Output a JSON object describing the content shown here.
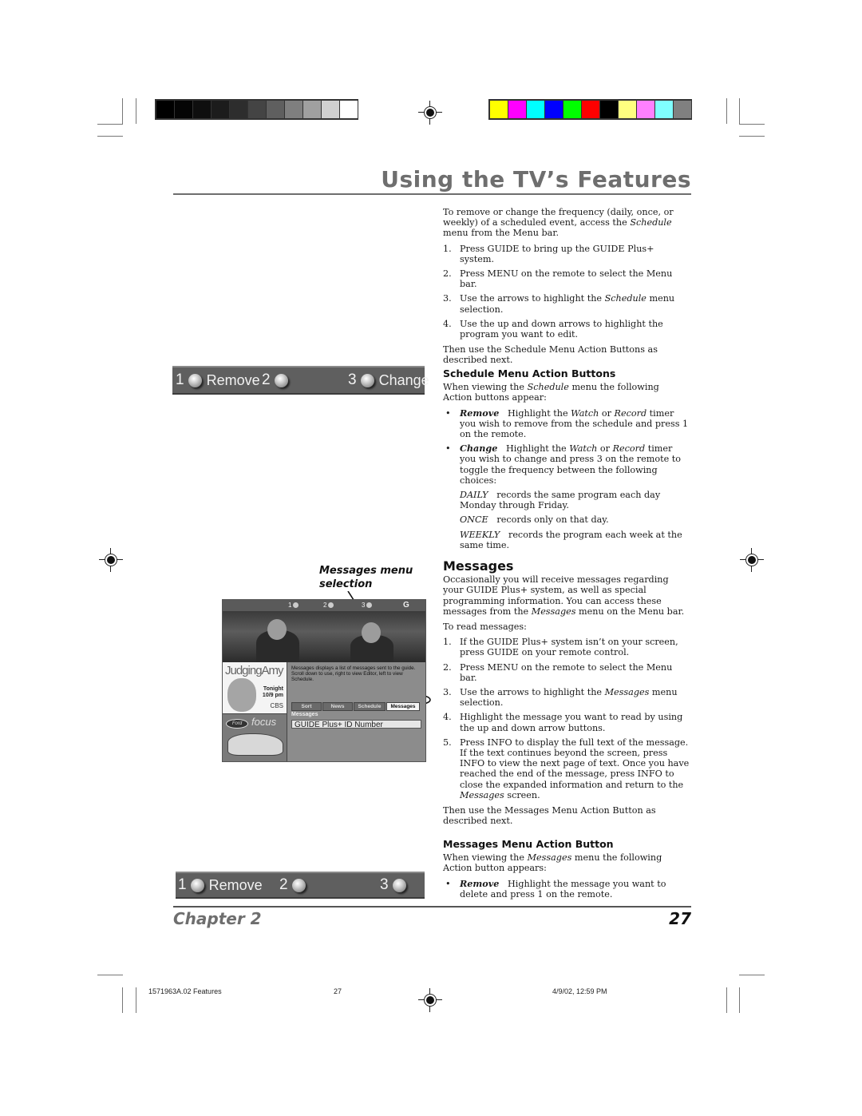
{
  "print_marks": {
    "grayscale_bar": [
      "#000000",
      "#050505",
      "#0f0f0f",
      "#1c1c1c",
      "#2d2d2d",
      "#444444",
      "#5f5f5f",
      "#7f7f7f",
      "#a0a0a0",
      "#d0d0d0",
      "#ffffff"
    ],
    "color_bar": [
      "#ffff00",
      "#ff00ff",
      "#00ffff",
      "#0000ff",
      "#00ff00",
      "#ff0000",
      "#000000",
      "#ffff80",
      "#ff80ff",
      "#80ffff",
      "#808080"
    ]
  },
  "header": {
    "title": "Using the TV’s Features"
  },
  "intro": {
    "p1_a": "To remove or change the frequency (daily, once, or weekly) of a scheduled event, access the ",
    "p1_em": "Schedule",
    "p1_b": " menu from the Menu bar.",
    "steps": [
      {
        "n": "1.",
        "a": "Press GUIDE to bring up the GUIDE Plus+ system.",
        "em": "",
        "b": ""
      },
      {
        "n": "2.",
        "a": "Press MENU on the remote to select the Menu bar.",
        "em": "",
        "b": ""
      },
      {
        "n": "3.",
        "a": "Use the arrows to highlight the ",
        "em": "Schedule",
        "b": " menu selection."
      },
      {
        "n": "4.",
        "a": "Use the up and down arrows to highlight the program you want to edit.",
        "em": "",
        "b": ""
      }
    ],
    "closing": "Then use the Schedule Menu Action Buttons as described next."
  },
  "schedule_action_bar": {
    "k1": "1",
    "k1_label": "Remove",
    "k2": "2",
    "k2_label": "",
    "k3": "3",
    "k3_label": "Change"
  },
  "schedule_section": {
    "heading": "Schedule Menu Action Buttons",
    "intro_a": "When viewing the ",
    "intro_em": "Schedule",
    "intro_b": " menu the following Action buttons appear:",
    "bullet": "•",
    "remove_term": "Remove",
    "remove_a": "Highlight the ",
    "remove_em1": "Watch",
    "remove_b": " or ",
    "remove_em2": "Record",
    "remove_c": " timer you wish to remove from the schedule and press 1 on the remote.",
    "change_term": "Change",
    "change_a": "Highlight the ",
    "change_em1": "Watch",
    "change_b": " or ",
    "change_em2": "Record",
    "change_c": " timer you wish to change and press 3 on the remote to toggle the frequency between the following choices:",
    "choices": [
      {
        "term": "DAILY",
        "desc": "records the same program each day Monday through Friday."
      },
      {
        "term": "ONCE",
        "desc": "records only on that day."
      },
      {
        "term": "WEEKLY",
        "desc": "records the program each week at the same time."
      }
    ]
  },
  "callout": {
    "line1": "Messages menu",
    "line2": "selection"
  },
  "tv_screen": {
    "keys": [
      "1",
      "2",
      "3"
    ],
    "logo": "G",
    "promo_show": "JudgingAmy",
    "promo_tonight": "Tonight",
    "promo_time": "10/9 pm",
    "promo_network": "CBS",
    "ad_logo": "Ford",
    "ad_brand": "focus",
    "description": "Messages displays a list of messages sent to the guide. Scroll down to use, right to view Editor, left to view Schedule.",
    "tabs": [
      "Sort",
      "News",
      "Schedule",
      "Messages"
    ],
    "active_tab": "Messages",
    "section_label": "Messages",
    "list_item": "GUIDE Plus+ ID Number"
  },
  "messages_section": {
    "heading": "Messages",
    "p1_a": "Occasionally you will receive messages regarding your GUIDE Plus+ system, as well as special programming information.  You can access these messages from the ",
    "p1_em": "Messages",
    "p1_b": " menu on the Menu bar.",
    "p2": "To read messages:",
    "steps": [
      {
        "n": "1.",
        "a": "If the GUIDE Plus+ system isn’t on your screen, press GUIDE on your remote control.",
        "em": "",
        "b": ""
      },
      {
        "n": "2.",
        "a": "Press MENU on the remote to select the Menu bar.",
        "em": "",
        "b": ""
      },
      {
        "n": "3.",
        "a": "Use the arrows to highlight the ",
        "em": "Messages",
        "b": " menu selection."
      },
      {
        "n": "4.",
        "a": "Highlight the message you want to read by using the up and down arrow buttons.",
        "em": "",
        "b": ""
      },
      {
        "n": "5.",
        "a": "Press INFO to display the full text of the message. If the text continues beyond the screen, press INFO to view the next page of text. Once you have reached the end of the message, press INFO to close the expanded information and return to the ",
        "em": "Messages",
        "b": " screen."
      }
    ],
    "closing": "Then use the Messages Menu Action Button as described next."
  },
  "messages_action_section": {
    "heading": "Messages Menu Action Button",
    "intro_a": "When viewing the ",
    "intro_em": "Messages",
    "intro_b": " menu the following Action button appears:",
    "bullet": "•",
    "remove_term": "Remove",
    "remove_text": "Highlight the message you want to delete and press 1 on the remote."
  },
  "messages_action_bar": {
    "k1": "1",
    "k1_label": "Remove",
    "k2": "2",
    "k3": "3"
  },
  "footer": {
    "chapter": "Chapter 2",
    "page": "27"
  },
  "slug": {
    "file": "1571963A.02 Features",
    "page": "27",
    "date": "4/9/02, 12:59 PM"
  }
}
